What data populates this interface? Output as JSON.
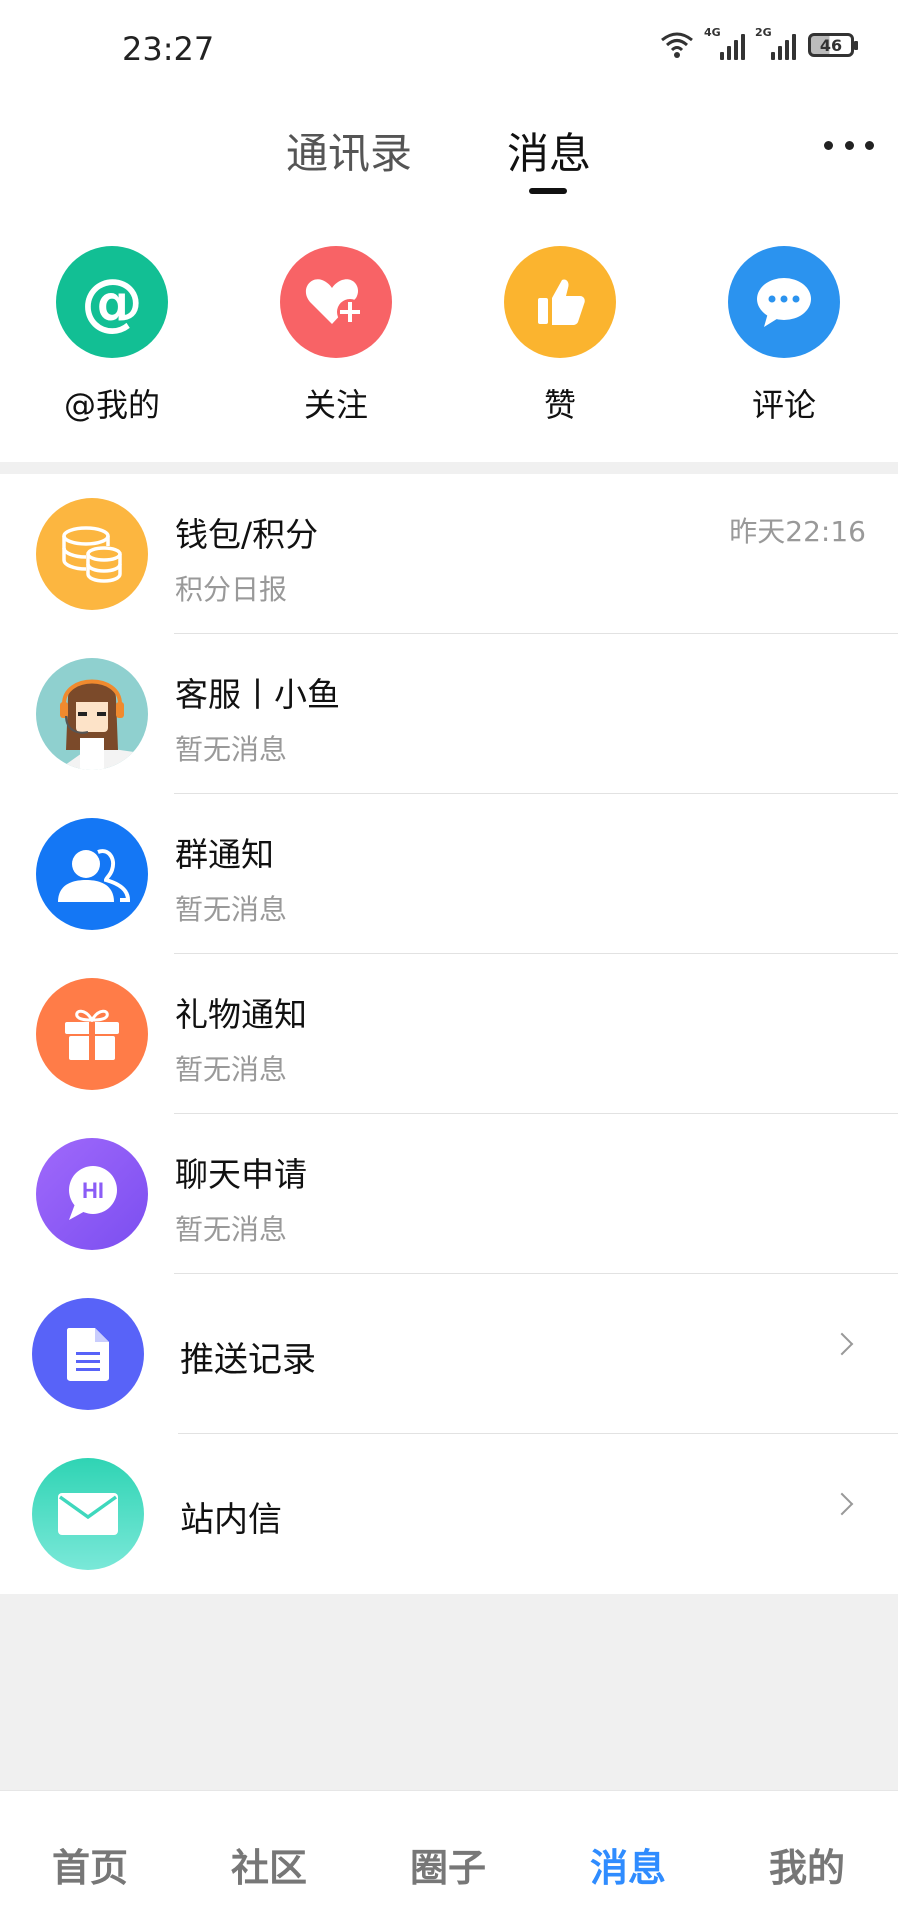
{
  "status_bar": {
    "time": "23:27",
    "network_1": "4G",
    "network_2": "2G",
    "battery": "46",
    "icons": [
      "wifi-icon",
      "signal-4g-icon",
      "signal-2g-icon",
      "battery-icon"
    ]
  },
  "header": {
    "tabs": [
      {
        "label": "通讯录",
        "active": false
      },
      {
        "label": "消息",
        "active": true
      }
    ],
    "more_icon": "more-dots-icon"
  },
  "quick_actions": [
    {
      "label": "@我的",
      "icon": "at-icon",
      "color": "#12bf94"
    },
    {
      "label": "关注",
      "icon": "heart-plus-icon",
      "color": "#f86366"
    },
    {
      "label": "赞",
      "icon": "thumbs-up-icon",
      "color": "#fbb42f"
    },
    {
      "label": "评论",
      "icon": "comment-bubble-icon",
      "color": "#2b93ef"
    }
  ],
  "messages": [
    {
      "title": "钱包/积分",
      "subtitle": "积分日报",
      "time": "昨天22:16",
      "icon": "coins-icon",
      "color": "#fcb640"
    },
    {
      "title": "客服丨小鱼",
      "subtitle": "暂无消息",
      "icon": "customer-service-avatar",
      "color": "#8fd0cf"
    },
    {
      "title": "群通知",
      "subtitle": "暂无消息",
      "icon": "group-users-icon",
      "color": "#1477f5"
    },
    {
      "title": "礼物通知",
      "subtitle": "暂无消息",
      "icon": "gift-icon",
      "color": "#ff7c48"
    },
    {
      "title": "聊天申请",
      "subtitle": "暂无消息",
      "icon": "hi-chat-icon",
      "color": "#8b5cf6"
    },
    {
      "title": "推送记录",
      "icon": "document-icon",
      "color": "#5863f8"
    },
    {
      "title": "站内信",
      "icon": "mail-icon",
      "color": "#3fd8bd"
    }
  ],
  "bottom_nav": [
    {
      "label": "首页",
      "active": false
    },
    {
      "label": "社区",
      "active": false
    },
    {
      "label": "圈子",
      "active": false
    },
    {
      "label": "消息",
      "active": true
    },
    {
      "label": "我的",
      "active": false
    }
  ],
  "colors": {
    "accent": "#2f8cff",
    "background": "#f0f0f0"
  }
}
